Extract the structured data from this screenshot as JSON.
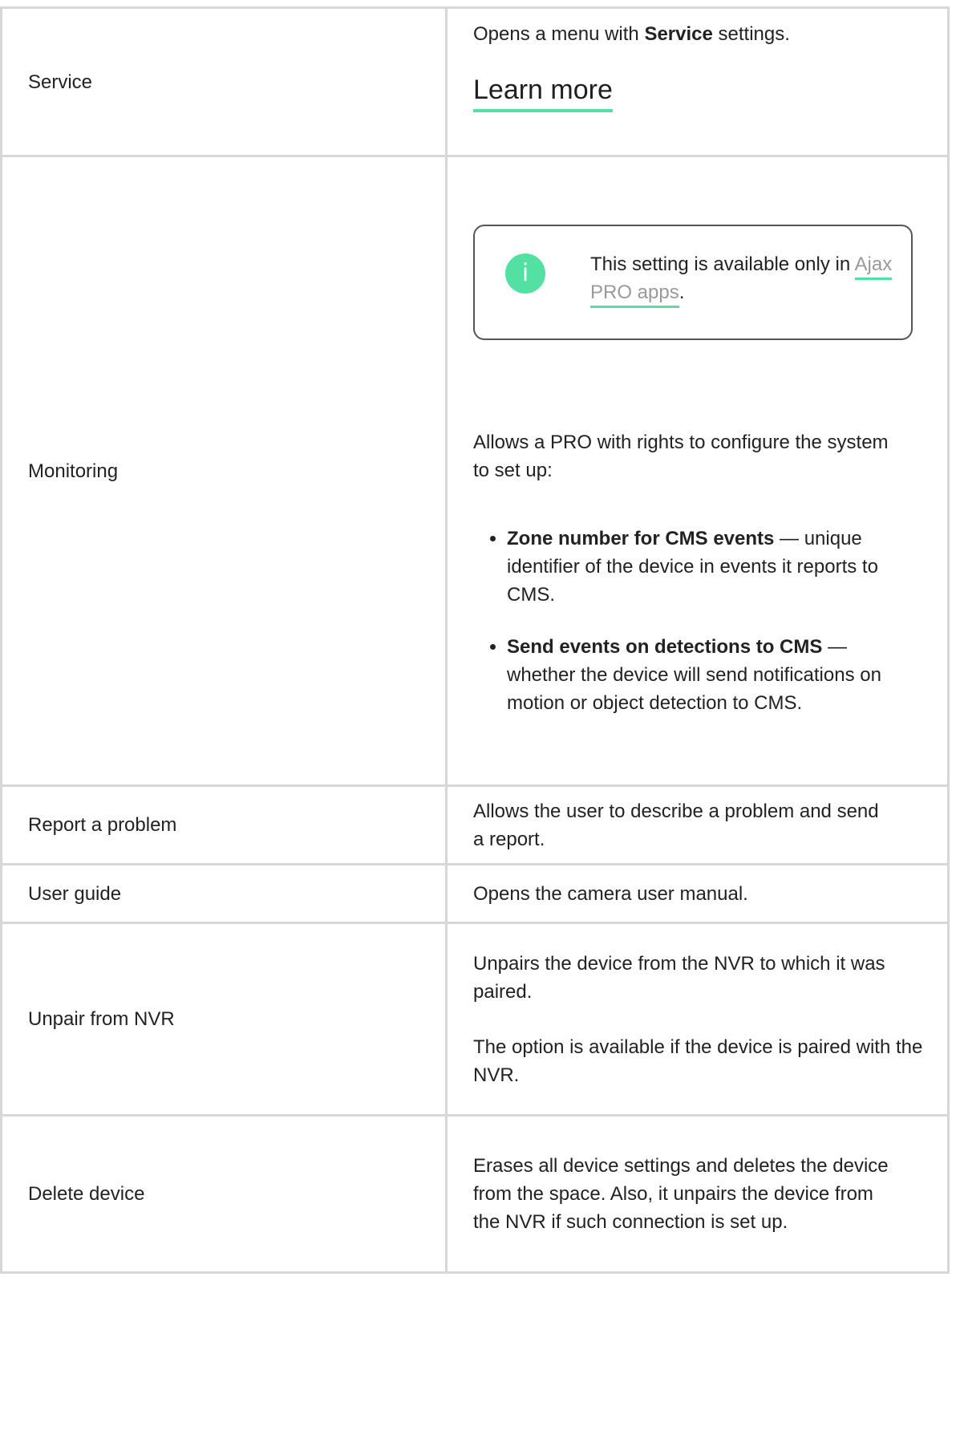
{
  "rows": {
    "service": {
      "name": "Service",
      "desc_pre": "Opens a menu with ",
      "desc_bold": "Service",
      "desc_post": " settings.",
      "link": "Learn more"
    },
    "monitoring": {
      "name": "Monitoring",
      "info_icon": "i",
      "info_text_pre": "This setting is available only in ",
      "info_link": "Ajax PRO apps",
      "info_text_post": ".",
      "intro": "Allows a PRO with rights to configure the system to set up:",
      "bullets": [
        {
          "bold": "Zone number for CMS events",
          "text": " — unique identifier of the device in events it reports to CMS."
        },
        {
          "bold": "Send events on detections to CMS",
          "text": " — whether the device will send notifications on motion or object detection to CMS."
        }
      ]
    },
    "report": {
      "name": "Report a problem",
      "desc": "Allows the user to describe a problem and send a report."
    },
    "guide": {
      "name": "User guide",
      "desc": "Opens the camera user manual."
    },
    "unpair": {
      "name": "Unpair from NVR",
      "desc1": "Unpairs the device from the NVR to which it was paired.",
      "desc2": "The option is available if the device is paired with the NVR."
    },
    "delete": {
      "name": "Delete device",
      "desc": "Erases all device settings and deletes the device from the space. Also, it unpairs the device from the NVR if such connection is set up."
    }
  },
  "colors": {
    "accent": "#52e1a2",
    "border": "#d7d7d7",
    "text": "#222222",
    "link_muted": "#9a9a9a"
  }
}
